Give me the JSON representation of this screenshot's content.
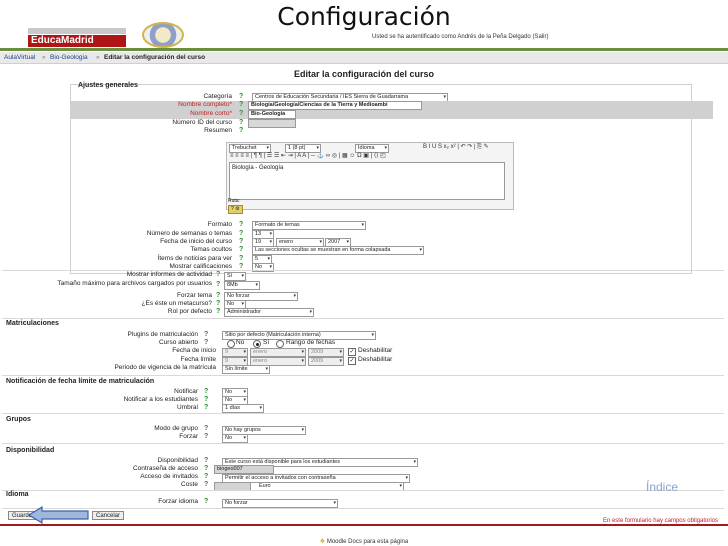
{
  "slide": {
    "title": "Configuración",
    "indice": "Índice"
  },
  "header": {
    "logo_text": "EducaMadrid",
    "login_info": "Usted se ha autentificado como Andrés de la Peña Delgado (Salir)"
  },
  "breadcrumb": [
    "AulaVirtual",
    "Bio-Geologia",
    "Editar la configuración del curso"
  ],
  "page_heading": "Editar la configuración del curso",
  "general": {
    "legend": "Ajustes generales",
    "categoria_label": "Categoría",
    "categoria_value": "Centros de Educación Secundaria / IES Sierra de Guadarrama",
    "nombre_completo_label": "Nombre completo*",
    "nombre_completo_value": "Biología/Geología/Ciencias de la Tierra y Medioambi",
    "nombre_corto_label": "Nombre corto*",
    "nombre_corto_value": "Bio-Geología",
    "numero_id_label": "Número ID del curso",
    "resumen_label": "Resumen",
    "editor": {
      "font_value": "Trebuchet",
      "size_value": "1 (8 pt)",
      "lang_value": "Idioma",
      "toolbar_row1": "B  I  U  S  x₂  x²  |  ↶  ↷  |  ⎘  ✎",
      "toolbar_row2": "≡  ≡  ≡  ≡  |  ¶  ¶  |  ☰  ☰  ⇤  ⇥  |  A  A  |  ─  ⚓  ∞  ◎  |  ▦  ☺  Ω  ▣  |  ⟨⟩  ◰",
      "content": "Biología - Geología",
      "path_label": "Ruta:",
      "toggle_label": "? ⚙"
    },
    "formato_label": "Formato",
    "formato_value": "Formato de temas",
    "numero_semanas_label": "Número de semanas o temas",
    "numero_semanas_value": "13",
    "fecha_inicio_label": "Fecha de inicio del curso",
    "fecha_inicio_day": "19",
    "fecha_inicio_month": "enero",
    "fecha_inicio_year": "2007",
    "temas_ocultos_label": "Temas ocultos",
    "temas_ocultos_value": "Las secciones ocultas se muestran en forma colapsada",
    "items_noticias_label": "Ítems de noticias para ver",
    "items_noticias_value": "5",
    "mostrar_calificaciones_label": "Mostrar calificaciones",
    "mostrar_calificaciones_value": "No",
    "mostrar_informes_label": "Mostrar informes de actividad",
    "mostrar_informes_value": "Sí",
    "tamano_maximo_label": "Tamaño máximo para archivos cargados por usuarios",
    "tamano_maximo_value": "8Mb",
    "forzar_tema_label": "Forzar tema",
    "forzar_tema_value": "No forzar",
    "metacurso_label": "¿Es éste un metacurso?",
    "metacurso_value": "No",
    "rol_defecto_label": "Rol por defecto",
    "rol_defecto_value": "Administrador"
  },
  "matriculaciones": {
    "legend": "Matriculaciones",
    "plugins_label": "Plugins de matriculación",
    "plugins_value": "Sitio por defecto (Matriculación interna)",
    "curso_abierto_label": "Curso abierto",
    "opt_no": "No",
    "opt_si": "Sí",
    "opt_rango": "Rango de fechas",
    "fecha_inicio_label": "Fecha de inicio",
    "fecha_limite_label": "Fecha límite",
    "day_value": "9",
    "month_value": "enero",
    "year_value": "2009",
    "deshabilitar_label": "Deshabilitar",
    "periodo_label": "Periodo de vigencia de la matrícula",
    "periodo_value": "Sin límite"
  },
  "notificacion": {
    "legend": "Notificación de fecha límite de matriculación",
    "notificar_label": "Notificar",
    "notificar_value": "No",
    "notificar_estudiantes_label": "Notificar a los estudiantes",
    "notificar_estudiantes_value": "No",
    "umbral_label": "Umbral",
    "umbral_value": "1 días"
  },
  "grupos": {
    "legend": "Grupos",
    "modo_label": "Modo de grupo",
    "modo_value": "No hay grupos",
    "forzar_label": "Forzar",
    "forzar_value": "No"
  },
  "disponibilidad": {
    "legend": "Disponibilidad",
    "disponibilidad_label": "Disponibilidad",
    "disponibilidad_value": "Este curso está disponible para los estudiantes",
    "contrasena_label": "Contraseña de acceso",
    "contrasena_value": "biogeo007",
    "acceso_invitados_label": "Acceso de invitados",
    "acceso_invitados_value": "Permitir el acceso a invitados con contraseña",
    "coste_label": "Coste",
    "coste_value": "Euro"
  },
  "idioma": {
    "legend": "Idioma",
    "forzar_idioma_label": "Forzar idioma",
    "forzar_idioma_value": "No forzar"
  },
  "buttons": {
    "save": "Guardar",
    "cancel": "Cancelar"
  },
  "required_note": "En este formulario hay campos obligatorios",
  "footer_docs": "Moodle Docs para esta página"
}
